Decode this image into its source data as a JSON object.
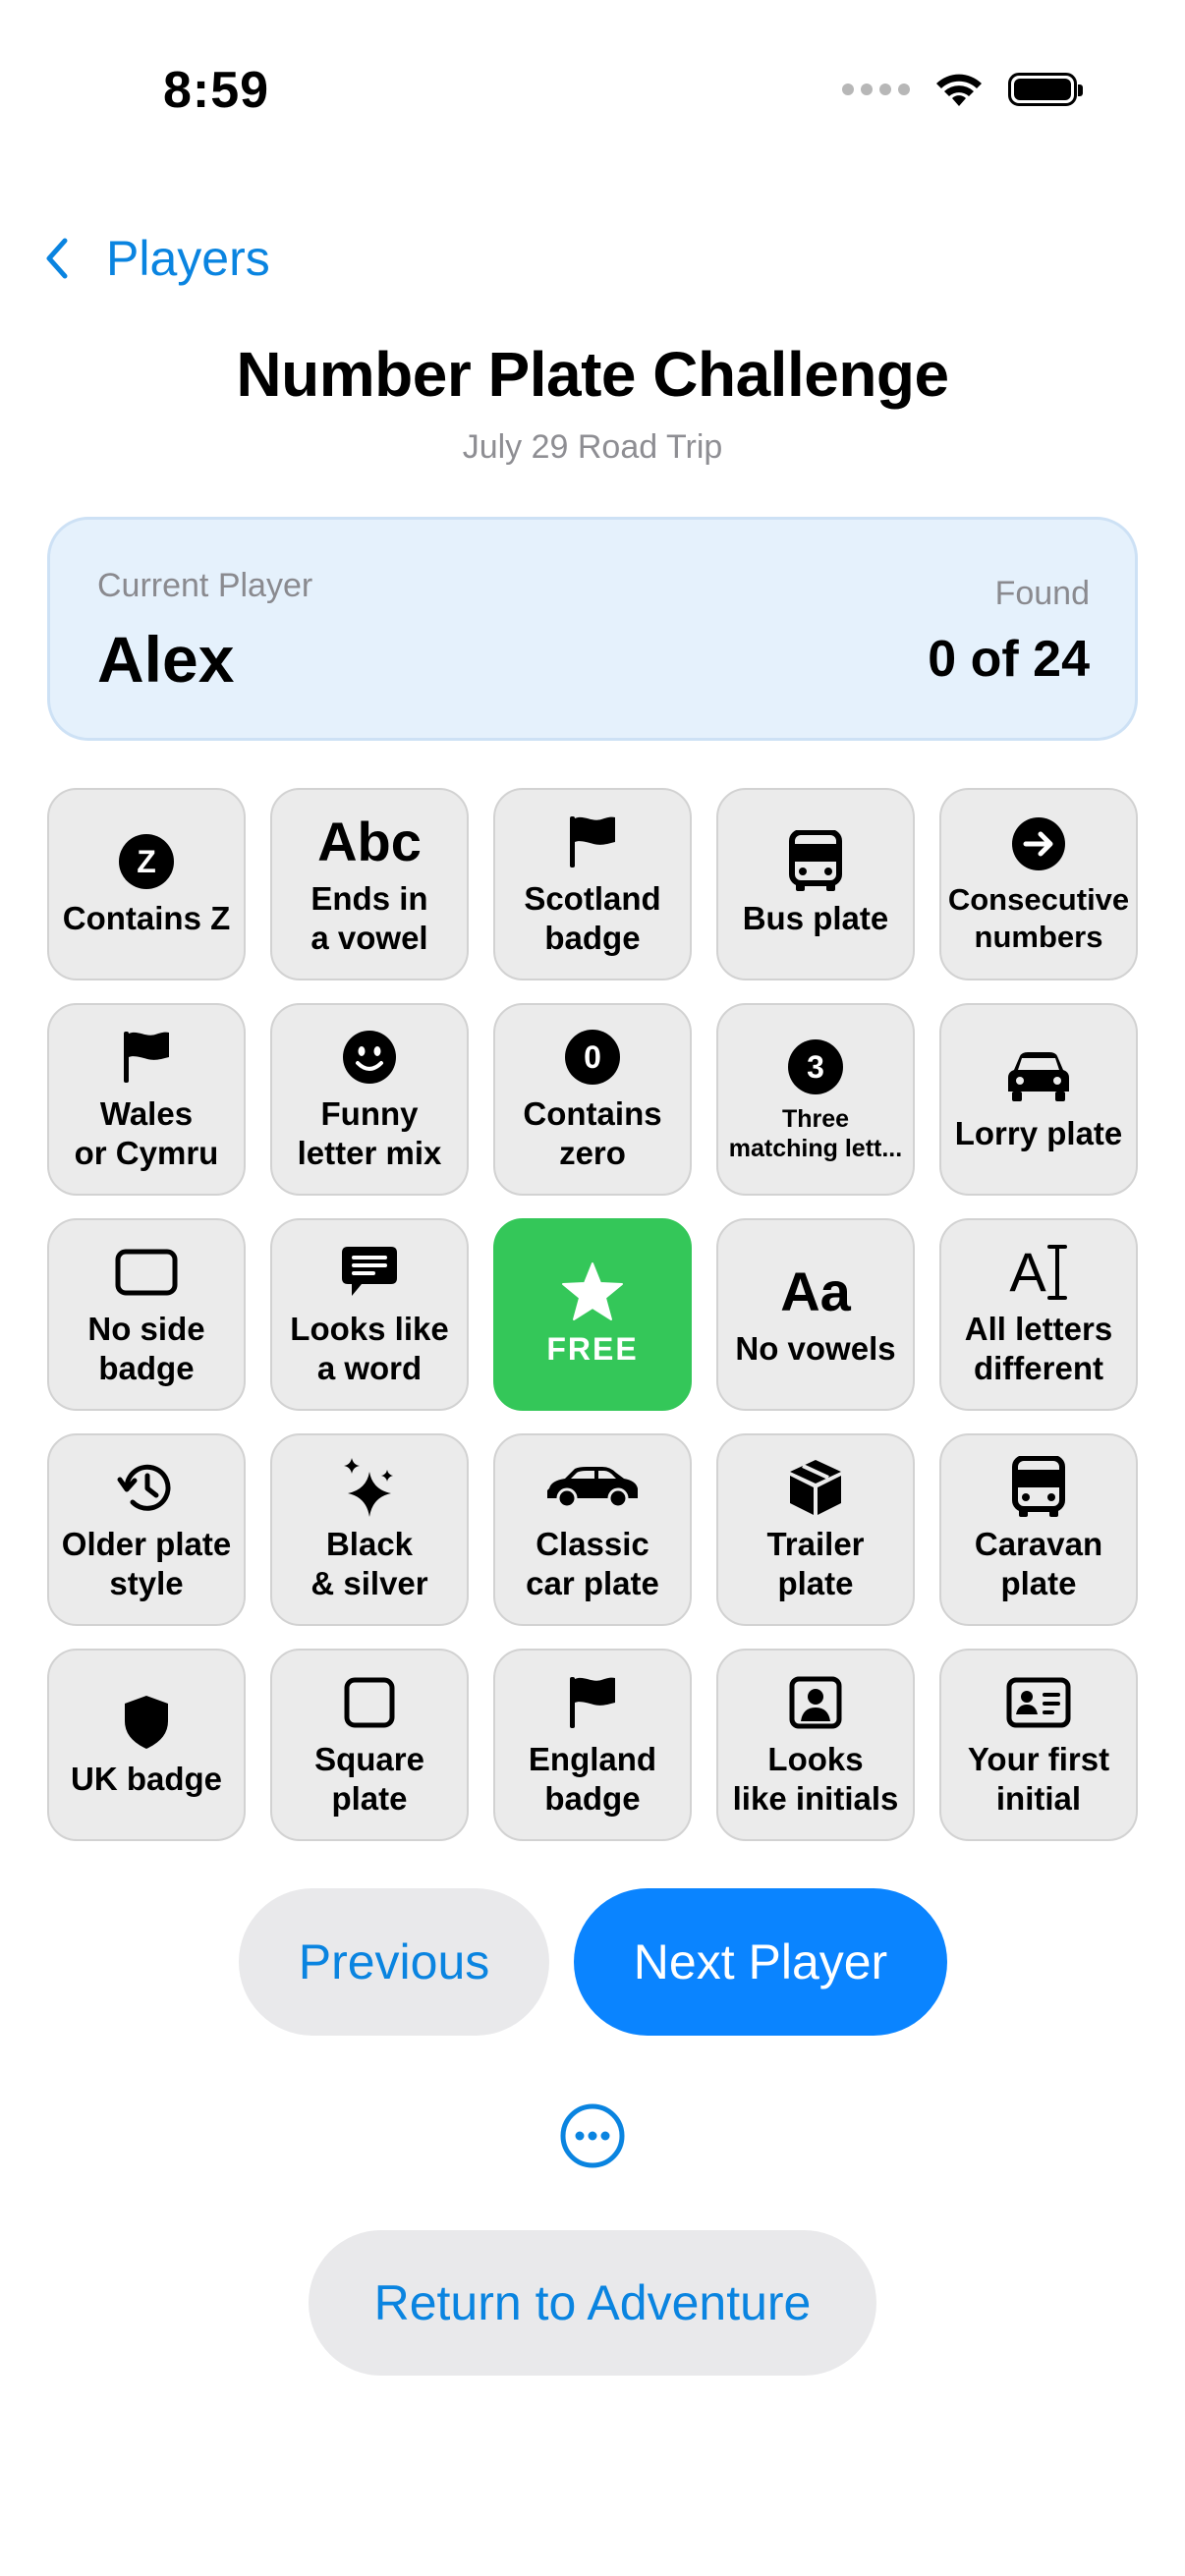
{
  "status_bar": {
    "time": "8:59",
    "icons": [
      "signal-icon",
      "wifi-icon",
      "battery-icon"
    ]
  },
  "nav": {
    "back_label": "Players"
  },
  "header": {
    "title": "Number Plate Challenge",
    "subtitle": "July 29 Road Trip"
  },
  "player_card": {
    "current_label": "Current Player",
    "player_name": "Alex",
    "found_label": "Found",
    "found_value": "0 of 24"
  },
  "tiles": [
    {
      "label": "Contains Z",
      "icon": "z-circle-icon",
      "glyph": "Z"
    },
    {
      "label": "Ends in\na vowel",
      "icon": "abc-text-icon",
      "glyph": "Abc"
    },
    {
      "label": "Scotland\nbadge",
      "icon": "flag-icon"
    },
    {
      "label": "Bus plate",
      "icon": "bus-icon"
    },
    {
      "label": "Consecutive\nnumbers",
      "icon": "arrow-right-circle-icon"
    },
    {
      "label": "Wales\nor Cymru",
      "icon": "flag-icon"
    },
    {
      "label": "Funny\nletter mix",
      "icon": "smiley-icon"
    },
    {
      "label": "Contains\nzero",
      "icon": "zero-circle-icon",
      "glyph": "0"
    },
    {
      "label": "Three\nmatching lett...",
      "icon": "three-circle-icon",
      "glyph": "3"
    },
    {
      "label": "Lorry plate",
      "icon": "car-front-icon"
    },
    {
      "label": "No side\nbadge",
      "icon": "rectangle-icon"
    },
    {
      "label": "Looks like\na word",
      "icon": "speech-bubble-icon"
    },
    {
      "label": "FREE",
      "icon": "star-icon",
      "free": true
    },
    {
      "label": "No vowels",
      "icon": "aa-text-icon",
      "glyph": "Aa"
    },
    {
      "label": "All letters\ndifferent",
      "icon": "text-cursor-icon",
      "glyph": "A"
    },
    {
      "label": "Older plate\nstyle",
      "icon": "history-clock-icon"
    },
    {
      "label": "Black\n& silver",
      "icon": "sparkles-icon"
    },
    {
      "label": "Classic\ncar plate",
      "icon": "car-side-icon"
    },
    {
      "label": "Trailer\nplate",
      "icon": "box-icon"
    },
    {
      "label": "Caravan\nplate",
      "icon": "bus-icon"
    },
    {
      "label": "UK badge",
      "icon": "shield-icon"
    },
    {
      "label": "Square\nplate",
      "icon": "square-icon"
    },
    {
      "label": "England\nbadge",
      "icon": "flag-icon"
    },
    {
      "label": "Looks\nlike initials",
      "icon": "person-square-icon"
    },
    {
      "label": "Your first\ninitial",
      "icon": "id-card-icon"
    }
  ],
  "actions": {
    "previous_label": "Previous",
    "next_label": "Next Player",
    "more_icon": "ellipsis-circle-icon",
    "return_label": "Return to Adventure"
  },
  "colors": {
    "accent": "#0a84ff",
    "link": "#0a84e0",
    "free_tile": "#34c759",
    "card_bg": "#e5f1fc",
    "tile_bg": "#ebebeb"
  }
}
